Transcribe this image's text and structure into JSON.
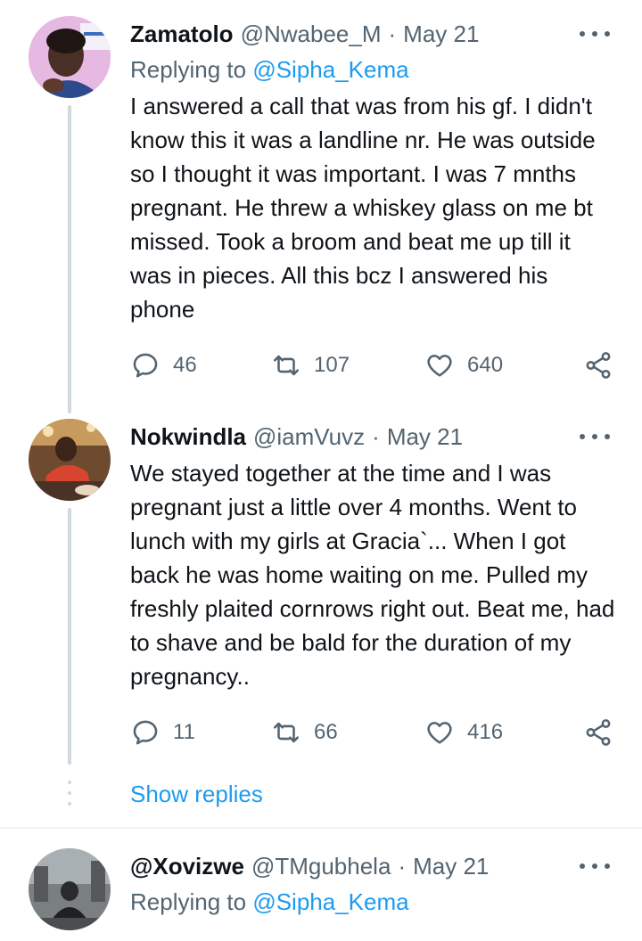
{
  "tweets": [
    {
      "name": "Zamatolo",
      "handle": "@Nwabee_M",
      "separator": "·",
      "date": "May 21",
      "reply_prefix": "Replying to ",
      "reply_handle": "@Sipha_Kema",
      "text": "I answered a call that was from his gf. I didn't know this it was a landline nr. He was outside so I thought it was important. I was 7 mnths pregnant.  He threw a whiskey glass on me bt missed. Took a broom and beat me up till it was in pieces. All this bcz I answered his phone",
      "replies": "46",
      "retweets": "107",
      "likes": "640"
    },
    {
      "name": "Nokwindla",
      "handle": "@iamVuvz",
      "separator": "·",
      "date": "May 21",
      "text": "We stayed together at the time and I was pregnant just a little over 4 months. Went to lunch with my girls at Gracia`... When I got back he was home waiting on me. Pulled my freshly plaited cornrows right out. Beat me, had to shave and be bald for the duration of my pregnancy..",
      "replies": "11",
      "retweets": "66",
      "likes": "416"
    },
    {
      "name": "@Xovizwe",
      "handle": "@TMgubhela",
      "separator": "·",
      "date": "May 21",
      "reply_prefix": "Replying to ",
      "reply_handle": "@Sipha_Kema"
    }
  ],
  "show_replies": "Show replies",
  "icons": {
    "reply": "reply-icon",
    "retweet": "retweet-icon",
    "like": "heart-icon",
    "share": "share-icon",
    "more": "more-icon"
  },
  "colors": {
    "link": "#1d9bf0",
    "secondary": "#536471",
    "thread_line": "#cfd9de"
  }
}
